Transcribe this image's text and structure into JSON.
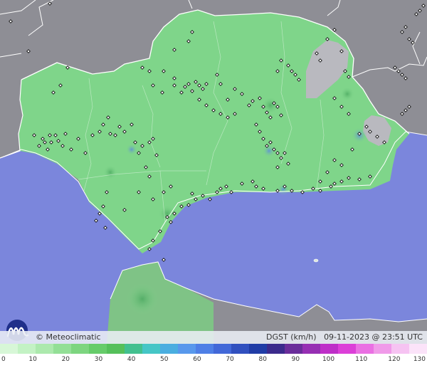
{
  "map": {
    "brand": "© Meteoclimatic",
    "variable": "DGST (km/h)",
    "datetime": "09-11-2023 @ 23:51 UTC",
    "colors": {
      "sea": "#7b86dc",
      "land_outside": "#8e8e95",
      "region_base": "#7fd58a",
      "high_ground": "#b9b9bf",
      "border": "#ffffff"
    },
    "legend": {
      "ticks": [
        "0",
        "10",
        "20",
        "30",
        "40",
        "50",
        "60",
        "70",
        "80",
        "90",
        "100",
        "110",
        "120",
        "130"
      ],
      "range": [
        0,
        130
      ],
      "colors": [
        "#d7f7d7",
        "#c3f2c4",
        "#ace9ad",
        "#93df96",
        "#7dd580",
        "#66cc6a",
        "#55c05a",
        "#42c08f",
        "#45c6c6",
        "#4aaee0",
        "#5898ec",
        "#4e7fe6",
        "#4268d8",
        "#3150bf",
        "#203ca6",
        "#3b2a8c",
        "#6a2d9a",
        "#962fb3",
        "#be2fc8",
        "#dc3fd8",
        "#ea70e3",
        "#f09ae9",
        "#f6c3f2",
        "#fbe3f9"
      ]
    }
  }
}
